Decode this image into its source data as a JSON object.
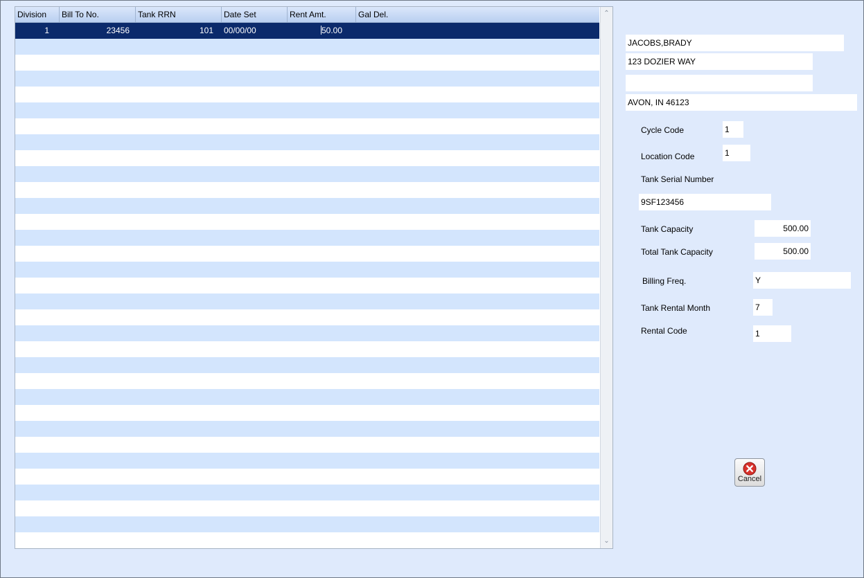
{
  "grid": {
    "columns": [
      "Division",
      "Bill To No.",
      "Tank RRN",
      "Date Set",
      "Rent Amt.",
      "Gal Del."
    ],
    "rows": [
      {
        "division": "1",
        "bill_to_no": "23456",
        "tank_rrn": "101",
        "date_set": "00/00/00",
        "rent_amt": "50.00",
        "gal_del": ""
      }
    ]
  },
  "customer": {
    "name": "JACOBS,BRADY",
    "address1": "123 DOZIER WAY",
    "address2": "",
    "city_state_zip": "AVON, IN 46123"
  },
  "details": {
    "cycle_code_label": "Cycle Code",
    "cycle_code": "1",
    "location_code_label": "Location Code",
    "location_code": "1",
    "tank_serial_label": "Tank Serial Number",
    "tank_serial": "9SF123456",
    "tank_capacity_label": "Tank Capacity",
    "tank_capacity": "500.00",
    "total_tank_capacity_label": "Total Tank Capacity",
    "total_tank_capacity": "500.00",
    "billing_freq_label": "Billing Freq.",
    "billing_freq": "Y",
    "tank_rental_month_label": "Tank Rental Month",
    "tank_rental_month": "7",
    "rental_code_label": "Rental Code",
    "rental_code": "1"
  },
  "buttons": {
    "cancel_label": "Cancel",
    "cancel_icon": "cancel-x-icon"
  },
  "colors": {
    "selection": "#0b2a6b",
    "row_alt": "#d3e5fd",
    "background": "#dfeafc",
    "cancel_icon": "#d8322c"
  }
}
